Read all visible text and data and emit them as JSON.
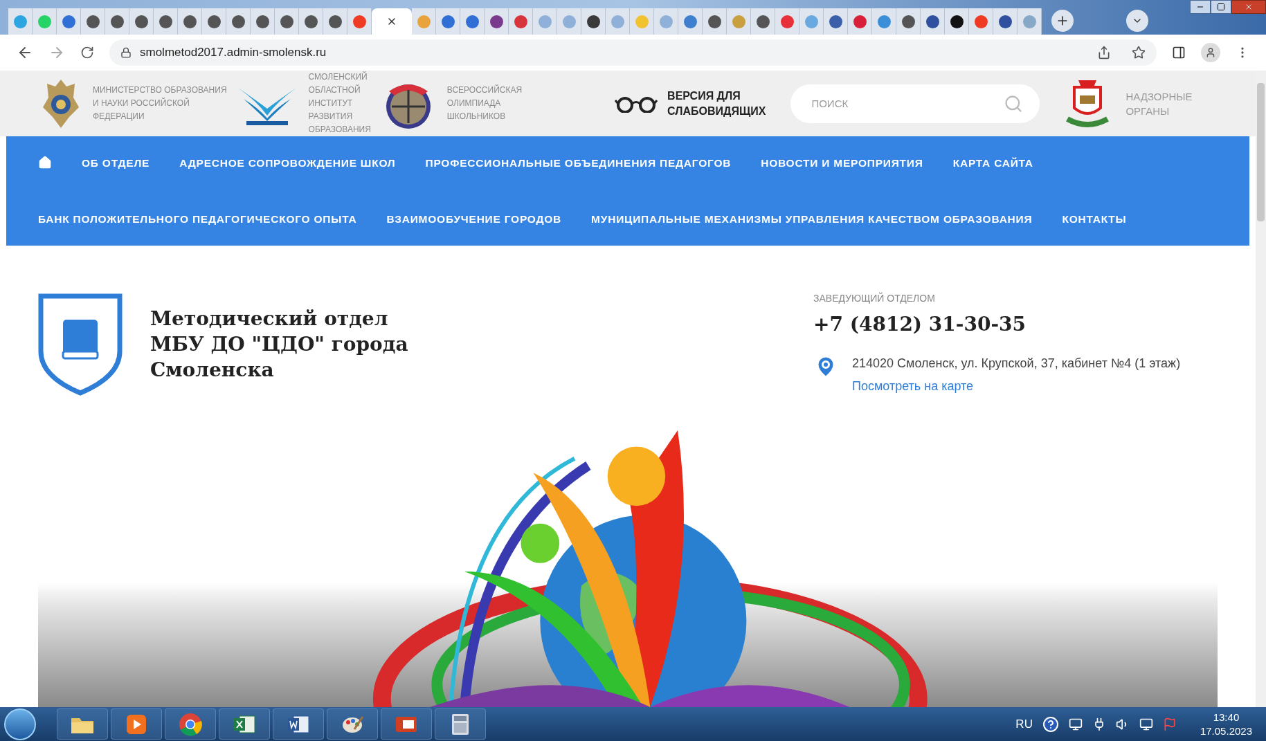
{
  "browser": {
    "tabs": [
      {
        "selected": false,
        "color": "#2ca5e0"
      },
      {
        "selected": false,
        "color": "#25d366"
      },
      {
        "selected": false,
        "color": "#2f6fd6"
      },
      {
        "selected": false,
        "color": "#555555"
      },
      {
        "selected": false,
        "color": "#555555"
      },
      {
        "selected": false,
        "color": "#555555"
      },
      {
        "selected": false,
        "color": "#555555"
      },
      {
        "selected": false,
        "color": "#555555"
      },
      {
        "selected": false,
        "color": "#555555"
      },
      {
        "selected": false,
        "color": "#555555"
      },
      {
        "selected": false,
        "color": "#555555"
      },
      {
        "selected": false,
        "color": "#555555"
      },
      {
        "selected": false,
        "color": "#555555"
      },
      {
        "selected": false,
        "color": "#555555"
      },
      {
        "selected": false,
        "color": "#ef3b24"
      },
      {
        "selected": true
      },
      {
        "selected": false,
        "color": "#e8a33c"
      },
      {
        "selected": false,
        "color": "#2f6fd6"
      },
      {
        "selected": false,
        "color": "#2f6fd6"
      },
      {
        "selected": false,
        "color": "#7a3b8f"
      },
      {
        "selected": false,
        "color": "#d8343c"
      },
      {
        "selected": false,
        "color": "#8fb0d8"
      },
      {
        "selected": false,
        "color": "#8fb0d8"
      },
      {
        "selected": false,
        "color": "#3a3a3a"
      },
      {
        "selected": false,
        "color": "#8fb0d8"
      },
      {
        "selected": false,
        "color": "#f2c230"
      },
      {
        "selected": false,
        "color": "#8fb0d8"
      },
      {
        "selected": false,
        "color": "#3f7fcf"
      },
      {
        "selected": false,
        "color": "#555555"
      },
      {
        "selected": false,
        "color": "#c8a040"
      },
      {
        "selected": false,
        "color": "#555555"
      },
      {
        "selected": false,
        "color": "#e8303a"
      },
      {
        "selected": false,
        "color": "#6aa8e0"
      },
      {
        "selected": false,
        "color": "#3b5fa8"
      },
      {
        "selected": false,
        "color": "#d8203a"
      },
      {
        "selected": false,
        "color": "#3a8fd8"
      },
      {
        "selected": false,
        "color": "#555555"
      },
      {
        "selected": false,
        "color": "#2f4f9f"
      },
      {
        "selected": false,
        "color": "#111111"
      },
      {
        "selected": false,
        "color": "#ef3b24"
      },
      {
        "selected": false,
        "color": "#2f4f9f"
      },
      {
        "selected": false,
        "color": "#88a8c8"
      }
    ],
    "address": "smolmetod2017.admin-smolensk.ru"
  },
  "header": {
    "partners": [
      {
        "kind": "emblem",
        "lines": [
          "МИНИСТЕРСТВО ОБРАЗОВАНИЯ",
          "И НАУКИ РОССИЙСКОЙ",
          "ФЕДЕРАЦИИ"
        ]
      },
      {
        "kind": "bird",
        "lines": [
          "СМОЛЕНСКИЙ",
          "ОБЛАСТНОЙ",
          "ИНСТИТУТ",
          "РАЗВИТИЯ",
          "ОБРАЗОВАНИЯ"
        ]
      },
      {
        "kind": "olympiad",
        "lines": [
          "ВСЕРОССИЙСКАЯ",
          "ОЛИМПИАДА",
          "ШКОЛЬНИКОВ"
        ]
      }
    ],
    "low_vision": [
      "ВЕРСИЯ ДЛЯ",
      "СЛАБОВИДЯЩИХ"
    ],
    "search": {
      "placeholder": "ПОИСК"
    },
    "supervisory": [
      "НАДЗОРНЫЕ",
      "ОРГАНЫ"
    ]
  },
  "nav": {
    "items": [
      "ОБ ОТДЕЛЕ",
      "АДРЕСНОЕ СОПРОВОЖДЕНИЕ ШКОЛ",
      "ПРОФЕССИОНАЛЬНЫЕ ОБЪЕДИНЕНИЯ ПЕДАГОГОВ",
      "НОВОСТИ И МЕРОПРИЯТИЯ",
      "КАРТА САЙТА",
      "БАНК ПОЛОЖИТЕЛЬНОГО ПЕДАГОГИЧЕСКОГО ОПЫТА",
      "ВЗАИМООБУЧЕНИЕ ГОРОДОВ",
      "МУНИЦИПАЛЬНЫЕ МЕХАНИЗМЫ УПРАВЛЕНИЯ КАЧЕСТВОМ ОБРАЗОВАНИЯ",
      "КОНТАКТЫ"
    ]
  },
  "department": {
    "title": [
      "Методический отдел",
      "МБУ ДО \"ЦДО\" города",
      "Смоленска"
    ],
    "head_label": "ЗАВЕДУЮЩИЙ ОТДЕЛОМ",
    "phone": "+7 (4812) 31-30-35",
    "address": "214020 Смоленск, ул. Крупской, 37, кабинет №4 (1 этаж)",
    "map_link": "Посмотреть на карте"
  },
  "taskbar": {
    "apps": [
      {
        "kind": "explorer"
      },
      {
        "kind": "player"
      },
      {
        "kind": "chrome"
      },
      {
        "kind": "excel"
      },
      {
        "kind": "word"
      },
      {
        "kind": "paint"
      },
      {
        "kind": "presentation"
      },
      {
        "kind": "calculator"
      }
    ],
    "language": "RU",
    "time": "13:40",
    "date": "17.05.2023"
  }
}
